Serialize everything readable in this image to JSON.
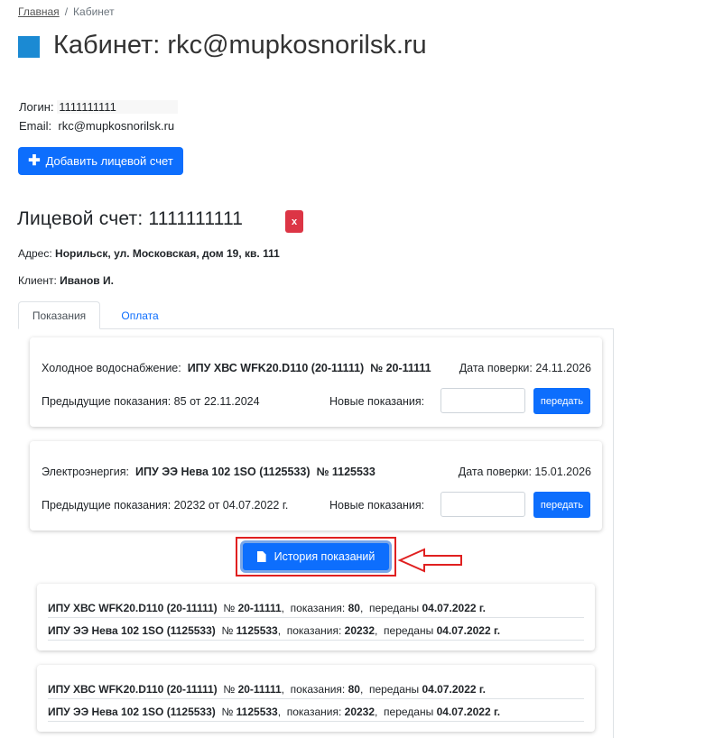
{
  "breadcrumb": {
    "home": "Главная",
    "separator": "/",
    "current": "Кабинет"
  },
  "page_title": "Кабинет: rkc@mupkosnorilsk.ru",
  "login": {
    "label": "Логин:",
    "value": "1111111111"
  },
  "email": {
    "label": "Email:",
    "value": "rkc@mupkosnorilsk.ru"
  },
  "add_account_button": "Добавить лицевой счет",
  "account": {
    "title": "Лицевой счет: 1111111111",
    "delete_label": "x",
    "address_label": "Адрес:",
    "address_value": "Норильск, ул. Московская, дом 19, кв. 111",
    "client_label": "Клиент:",
    "client_value": "Иванов И."
  },
  "tabs": [
    {
      "label": "Показания"
    },
    {
      "label": "Оплата"
    }
  ],
  "meters": [
    {
      "service": "Холодное водоснабжение:",
      "device": "ИПУ ХВС WFK20.D110 (20-11111)",
      "number": "№ 20-11111",
      "verification": "Дата поверки: 24.11.2026",
      "previous": "Предыдущие показания:  85 от 22.11.2024",
      "new_label": "Новые показания:",
      "new_value": "",
      "send_label": "передать"
    },
    {
      "service": "Электроэнергия:",
      "device": "ИПУ ЭЭ Нева 102 1SO (1125533)",
      "number": "№ 1125533",
      "verification": "Дата поверки: 15.01.2026",
      "previous": "Предыдущие показания:  20232 от 04.07.2022 г.",
      "new_label": "Новые показания:",
      "new_value": "",
      "send_label": "передать"
    }
  ],
  "history_button": "История показаний",
  "history": [
    {
      "rows": [
        {
          "device": "ИПУ ХВС WFK20.D110 (20-11111)",
          "number_label": "№",
          "number": "20-11111",
          "reading_label": "показания:",
          "reading": "80",
          "sent_label": "переданы",
          "sent": "04.07.2022 г."
        },
        {
          "device": "ИПУ ЭЭ Нева 102 1SO (1125533)",
          "number_label": "№",
          "number": "1125533",
          "reading_label": "показания:",
          "reading": "20232",
          "sent_label": "переданы",
          "sent": "04.07.2022 г."
        }
      ]
    },
    {
      "rows": [
        {
          "device": "ИПУ ХВС WFK20.D110 (20-11111)",
          "number_label": "№",
          "number": "20-11111",
          "reading_label": "показания:",
          "reading": "80",
          "sent_label": "переданы",
          "sent": "04.07.2022 г."
        },
        {
          "device": "ИПУ ЭЭ Нева 102 1SO (1125533)",
          "number_label": "№",
          "number": "1125533",
          "reading_label": "показания:",
          "reading": "20232",
          "sent_label": "переданы",
          "sent": "04.07.2022 г."
        }
      ]
    }
  ],
  "colors": {
    "primary": "#0d6efd",
    "danger": "#dc3545",
    "title_square": "#1b8ad3",
    "annotation": "#e02020"
  }
}
